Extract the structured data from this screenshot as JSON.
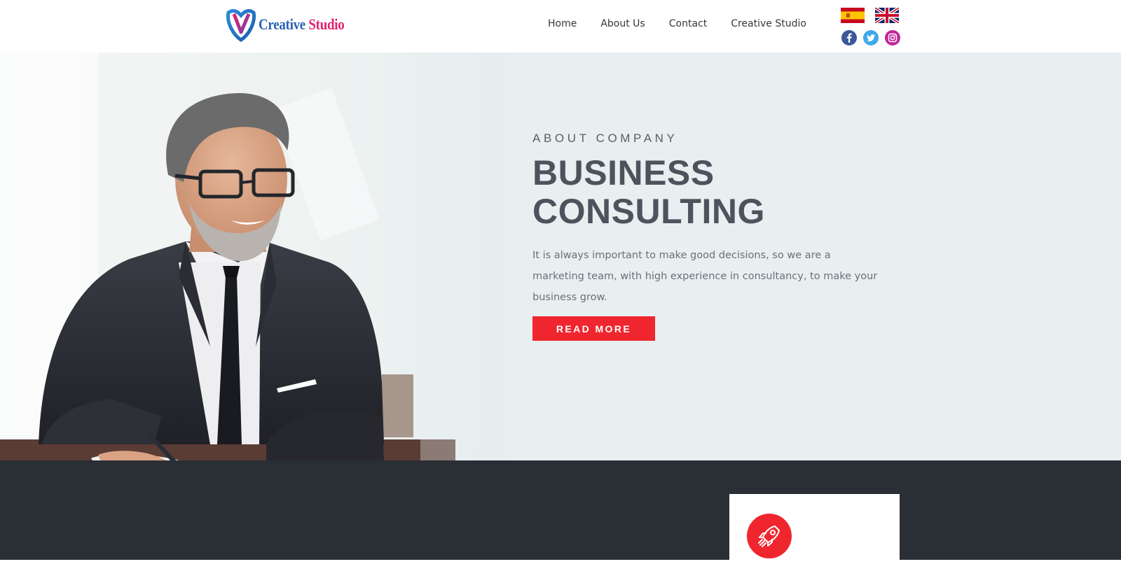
{
  "header": {
    "logo": {
      "word1": "Creative",
      "word2": "Studio"
    },
    "nav": [
      {
        "label": "Home"
      },
      {
        "label": "About Us"
      },
      {
        "label": "Contact"
      },
      {
        "label": "Creative Studio"
      }
    ],
    "languages": [
      "spain-flag-icon",
      "uk-flag-icon"
    ],
    "socials": [
      "facebook-icon",
      "twitter-icon",
      "instagram-icon"
    ]
  },
  "hero": {
    "eyebrow": "ABOUT COMPANY",
    "title_line1": "BUSINESS",
    "title_line2": "CONSULTING",
    "description": "It is always important to make good decisions, so we are a marketing team, with high experience in consultancy, to make your business grow.",
    "button_label": "READ MORE"
  },
  "feature_card": {
    "icon": "rocket-icon"
  },
  "colors": {
    "accent": "#f0262f",
    "hero_bg": "#e7eff0",
    "dark_bg": "#2a2e35",
    "logo_blue": "#2a63b5",
    "logo_pink": "#e2206f"
  }
}
